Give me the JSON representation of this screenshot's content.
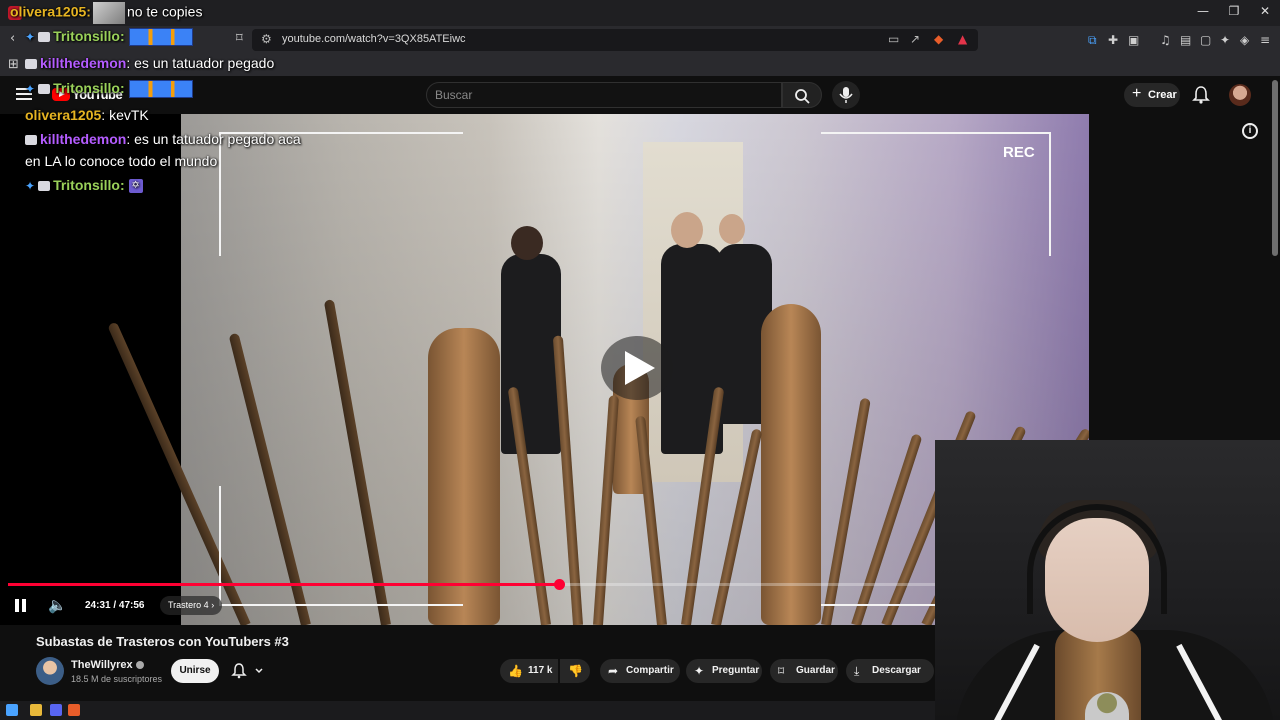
{
  "browser": {
    "tab_title": "no te copies",
    "url": "youtube.com/watch?v=3QX85ATEiwc"
  },
  "youtube": {
    "logo": "YouTube",
    "search_placeholder": "Buscar",
    "create_label": "Crear"
  },
  "video": {
    "rec_label": "REC",
    "progress_fraction": 0.515,
    "time_display": "24:31 / 47:56",
    "chapter": "Trastero 4",
    "title": "Subastas de Trasteros con YouTubers #3"
  },
  "channel": {
    "name": "TheWillyrex",
    "subscribers": "18.5 M de suscriptores",
    "join_label": "Unirse"
  },
  "actions": {
    "likes": "117 k",
    "share": "Compartir",
    "ask": "Preguntar",
    "save": "Guardar",
    "download": "Descargar"
  },
  "chat": {
    "messages": [
      {
        "user": "olivera1205:",
        "text": "no te copies"
      },
      {
        "user": "Tritonsillo:",
        "text": ""
      },
      {
        "user": "killthedemon",
        "text": ": es un tatuador pegado"
      },
      {
        "user": "Tritonsillo:",
        "text": ""
      },
      {
        "user": "olivera1205",
        "text": ": kevTK"
      },
      {
        "user": "killthedemon",
        "text": ": es un tatuador pegado aca"
      },
      {
        "user": "",
        "text": "en LA lo conoce todo el mundo"
      },
      {
        "user": "Tritonsillo:",
        "text": ""
      }
    ]
  },
  "icons": {
    "back": "back-icon",
    "search": "search-icon",
    "mic": "mic-icon",
    "bell": "bell-icon",
    "info": "info-icon",
    "pause": "pause-icon",
    "volume": "volume-icon"
  },
  "colors": {
    "accent_red": "#ff0033",
    "youtube_red": "#ff0000"
  }
}
